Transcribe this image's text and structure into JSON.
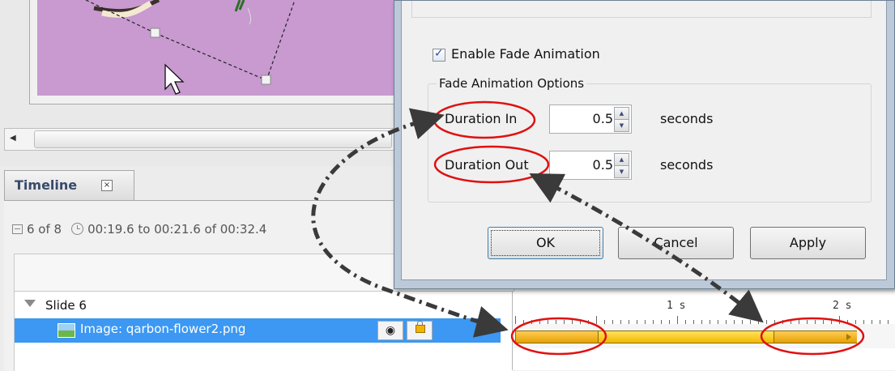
{
  "timeline_panel": {
    "tab_title": "Timeline",
    "tab_close_glyph": "⊠",
    "slide_counter": "6 of 8",
    "time_range": "00:19.6 to 00:21.6 of 00:32.4",
    "tree": {
      "slide_label": "Slide 6",
      "image_label": "Image: qarbon-flower2.png",
      "visibility_icon": "eye-icon",
      "lock_icon": "lock-icon"
    },
    "ruler": {
      "labels": [
        "1 s",
        "2 s"
      ]
    }
  },
  "dialog": {
    "enable_fade": {
      "label": "Enable Fade Animation",
      "checked": true
    },
    "fade_options": {
      "title": "Fade Animation Options",
      "duration_in": {
        "label": "Duration In",
        "value": "0.5",
        "unit": "seconds"
      },
      "duration_out": {
        "label": "Duration Out",
        "value": "0.5",
        "unit": "seconds"
      }
    },
    "buttons": {
      "ok": "OK",
      "cancel": "Cancel",
      "apply": "Apply"
    }
  },
  "canvas": {
    "background_color": "#c89ad0"
  },
  "annotation_colors": {
    "highlight_ring": "#e01010",
    "arrow": "#3a3a3a"
  }
}
